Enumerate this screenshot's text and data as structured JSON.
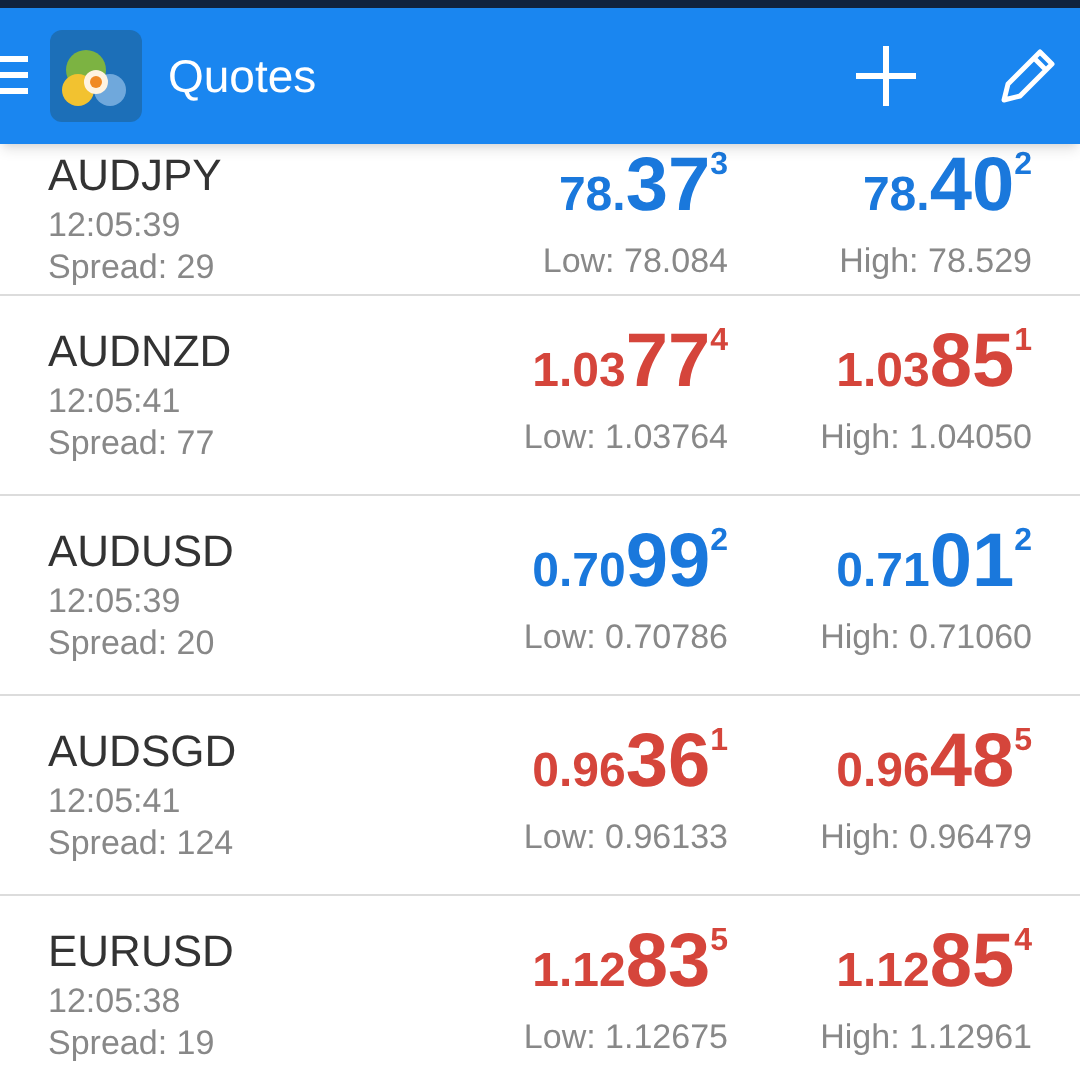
{
  "header": {
    "title": "Quotes"
  },
  "quotes": [
    {
      "symbol": "AUDJPY",
      "time": "12:05:39",
      "spread": "Spread: 29",
      "color": "#1a78dc",
      "bid": {
        "prefix": "78.",
        "big": "37",
        "sup": "3"
      },
      "ask": {
        "prefix": "78.",
        "big": "40",
        "sup": "2"
      },
      "low": "Low: 78.084",
      "high": "High: 78.529"
    },
    {
      "symbol": "AUDNZD",
      "time": "12:05:41",
      "spread": "Spread: 77",
      "color": "#d5453b",
      "bid": {
        "prefix": "1.03",
        "big": "77",
        "sup": "4"
      },
      "ask": {
        "prefix": "1.03",
        "big": "85",
        "sup": "1"
      },
      "low": "Low: 1.03764",
      "high": "High: 1.04050"
    },
    {
      "symbol": "AUDUSD",
      "time": "12:05:39",
      "spread": "Spread: 20",
      "color": "#1a78dc",
      "bid": {
        "prefix": "0.70",
        "big": "99",
        "sup": "2"
      },
      "ask": {
        "prefix": "0.71",
        "big": "01",
        "sup": "2"
      },
      "low": "Low: 0.70786",
      "high": "High: 0.71060"
    },
    {
      "symbol": "AUDSGD",
      "time": "12:05:41",
      "spread": "Spread: 124",
      "color": "#d5453b",
      "bid": {
        "prefix": "0.96",
        "big": "36",
        "sup": "1"
      },
      "ask": {
        "prefix": "0.96",
        "big": "48",
        "sup": "5"
      },
      "low": "Low: 0.96133",
      "high": "High: 0.96479"
    },
    {
      "symbol": "EURUSD",
      "time": "12:05:38",
      "spread": "Spread: 19",
      "color": "#d5453b",
      "bid": {
        "prefix": "1.12",
        "big": "83",
        "sup": "5"
      },
      "ask": {
        "prefix": "1.12",
        "big": "85",
        "sup": "4"
      },
      "low": "Low: 1.12675",
      "high": "High: 1.12961"
    }
  ]
}
